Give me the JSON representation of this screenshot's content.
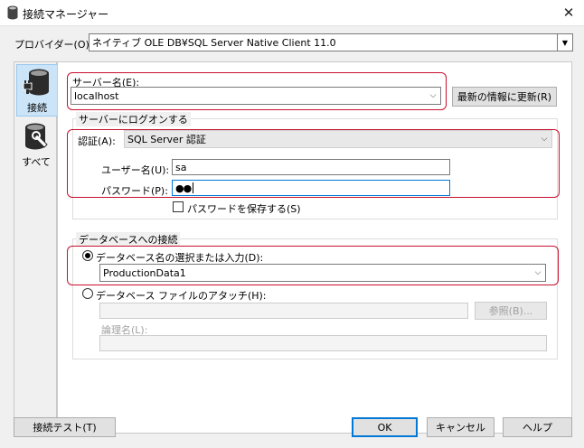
{
  "window": {
    "title": "接続マネージャー"
  },
  "provider": {
    "label": "プロバイダー(O):",
    "value": "ネイティブ OLE DB¥SQL Server Native Client 11.0"
  },
  "nav": {
    "items": [
      {
        "label": "接続",
        "icon": "database-plug-icon",
        "selected": true
      },
      {
        "label": "すべて",
        "icon": "database-wrench-icon",
        "selected": false
      }
    ]
  },
  "server": {
    "label": "サーバー名(E):",
    "value": "localhost",
    "refresh_button": "最新の情報に更新(R)"
  },
  "logon": {
    "group_title": "サーバーにログオンする",
    "auth_label": "認証(A):",
    "auth_value": "SQL Server 認証",
    "user_label": "ユーザー名(U):",
    "user_value": "sa",
    "password_label": "パスワード(P):",
    "password_value": "●●",
    "save_password_label": "パスワードを保存する(S)",
    "save_password_checked": false
  },
  "database": {
    "group_title": "データベースへの接続",
    "select_option_label": "データベース名の選択または入力(D):",
    "select_option_checked": true,
    "database_value": "ProductionData1",
    "attach_option_label": "データベース ファイルのアタッチ(H):",
    "attach_option_checked": false,
    "browse_button": "参照(B)...",
    "logical_name_label": "論理名(L):"
  },
  "footer": {
    "test_button": "接続テスト(T)",
    "ok_button": "OK",
    "cancel_button": "キャンセル",
    "help_button": "ヘルプ"
  },
  "colors": {
    "highlight": "#c8102e",
    "focus": "#0078d7",
    "selected_nav": "#cce4f7"
  }
}
